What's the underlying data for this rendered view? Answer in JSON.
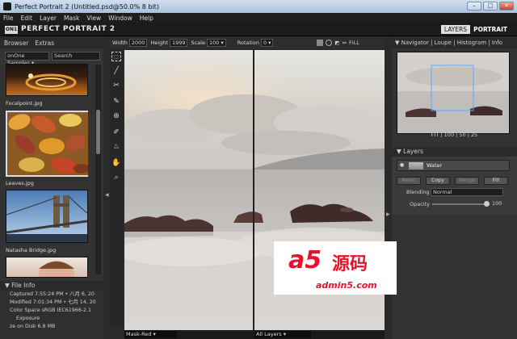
{
  "window": {
    "title": "Perfect Portrait 2 (Untitled.psd@50.0% 8 bit)"
  },
  "menu": [
    "File",
    "Edit",
    "Layer",
    "Mask",
    "View",
    "Window",
    "Help"
  ],
  "brand": {
    "logo": "ON1",
    "name": "PERFECT PORTRAIT 2"
  },
  "modes": {
    "layers": "LAYERS",
    "portrait": "PORTRAIT"
  },
  "left_panel": {
    "tabs": [
      "Browser",
      "Extras"
    ],
    "sample_select": "onOne Samples",
    "search_placeholder": "Search",
    "thumbnails": [
      "Focalpoint.jpg",
      "Leaves.jpg",
      "Natasha Bridge.jpg"
    ],
    "file_info": {
      "header": "File Info",
      "captured": "Captured   7:55:24 PM • 八月 6, 20",
      "modified": "Modified   7:01:34 PM • 七月 14, 20",
      "color_space": "Color Space  sRGB IEC61966-2.1",
      "exposure": "Exposure",
      "size_on_disk": "ze on Disk  6.8 MB"
    }
  },
  "canvas_toolbar": {
    "width_label": "Width",
    "width_value": "2000",
    "height_label": "Height",
    "height_value": "1999",
    "scale_label": "Scale",
    "scale_value": "100",
    "rotation_label": "Rotation",
    "rotation_value": "0",
    "fill_label": "FILL"
  },
  "canvas_footer": {
    "left_view": "Mask-Red",
    "right_view": "All Layers"
  },
  "right_panel": {
    "nav_tabs": "Navigator | Loupe | Histogram | Info",
    "zoom_options": "FIT  |  100  |  50  |  25",
    "layers_header": "Layers",
    "layer_name": "Water",
    "layer_buttons": [
      "Reset",
      "Copy",
      "Merge",
      "Fill"
    ],
    "blending_label": "Blending",
    "blending_value": "Normal",
    "opacity_label": "Opacity",
    "opacity_value": "100"
  },
  "watermark": {
    "main": "a5",
    "cn": "源码",
    "sub": "admin5.com"
  }
}
